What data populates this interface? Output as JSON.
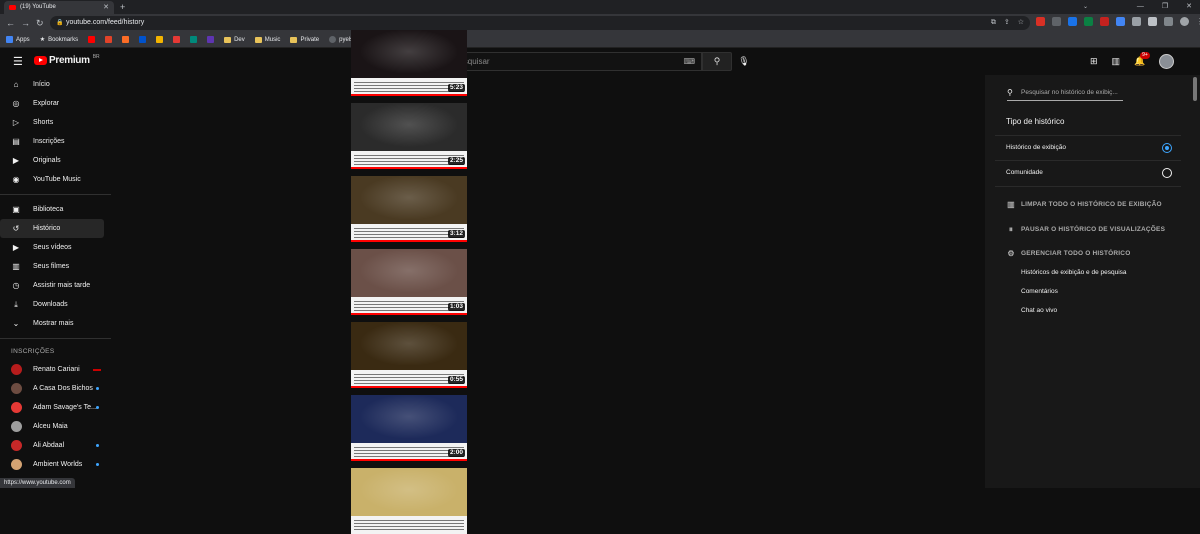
{
  "browser": {
    "tab_title": "(19) YouTube",
    "url": "youtube.com/feed/history",
    "bookmarks": [
      {
        "label": "Apps"
      },
      {
        "label": "Bookmarks"
      },
      {
        "label": "Dev"
      },
      {
        "label": "Music"
      },
      {
        "label": "Private"
      },
      {
        "label": "pyelsaaudio/record..."
      }
    ],
    "status_url": "https://www.youtube.com"
  },
  "header": {
    "logo_text": "Premium",
    "logo_country": "BR",
    "search_placeholder": "Pesquisar",
    "notification_count": "9+"
  },
  "guide": {
    "primary": [
      {
        "label": "Início",
        "icon": "home-icon",
        "glyph": "⌂"
      },
      {
        "label": "Explorar",
        "icon": "compass-icon",
        "glyph": "◎"
      },
      {
        "label": "Shorts",
        "icon": "shorts-icon",
        "glyph": "▷"
      },
      {
        "label": "Inscrições",
        "icon": "subscriptions-icon",
        "glyph": "▤"
      },
      {
        "label": "Originals",
        "icon": "originals-icon",
        "glyph": "▶"
      },
      {
        "label": "YouTube Music",
        "icon": "music-icon",
        "glyph": "◉"
      }
    ],
    "library": [
      {
        "label": "Biblioteca",
        "icon": "library-icon",
        "glyph": "▣"
      },
      {
        "label": "Histórico",
        "icon": "history-icon",
        "glyph": "↺",
        "active": true
      },
      {
        "label": "Seus vídeos",
        "icon": "your-videos-icon",
        "glyph": "▶"
      },
      {
        "label": "Seus filmes",
        "icon": "movies-icon",
        "glyph": "▥"
      },
      {
        "label": "Assistir mais tarde",
        "icon": "watch-later-icon",
        "glyph": "◷"
      },
      {
        "label": "Downloads",
        "icon": "download-icon",
        "glyph": "⤓"
      },
      {
        "label": "Mostrar mais",
        "icon": "chevron-down-icon",
        "glyph": "⌄"
      }
    ],
    "subscriptions_heading": "INSCRIÇÕES",
    "subscriptions": [
      {
        "label": "Renato Cariani",
        "avatar_color": "#b71c1c",
        "badge": "live"
      },
      {
        "label": "A Casa Dos Bichos",
        "avatar_color": "#6d4c41",
        "badge": "dot"
      },
      {
        "label": "Adam Savage's Te...",
        "avatar_color": "#e53935",
        "badge": "dot"
      },
      {
        "label": "Alceu Maia",
        "avatar_color": "#9e9e9e",
        "badge": ""
      },
      {
        "label": "Ali Abdaal",
        "avatar_color": "#c62828",
        "badge": "dot"
      },
      {
        "label": "Ambient Worlds",
        "avatar_color": "#d4a373",
        "badge": "dot"
      }
    ]
  },
  "feed": {
    "videos": [
      {
        "duration": "5:23",
        "scene_color": "#1a1416"
      },
      {
        "duration": "2:25",
        "scene_color": "#2b2b2b"
      },
      {
        "duration": "3:12",
        "scene_color": "#4a3a22"
      },
      {
        "duration": "1:03",
        "scene_color": "#6b5048"
      },
      {
        "duration": "0:55",
        "scene_color": "#3a2a12"
      },
      {
        "duration": "2:00",
        "scene_color": "#1d2a5a"
      },
      {
        "duration": "",
        "scene_color": "#c9b16a"
      }
    ]
  },
  "history_panel": {
    "search_placeholder": "Pesquisar no histórico de exibiç...",
    "type_title": "Tipo de histórico",
    "options": [
      {
        "label": "Histórico de exibição",
        "selected": true
      },
      {
        "label": "Comunidade",
        "selected": false
      }
    ],
    "actions": [
      {
        "label": "LIMPAR TODO O HISTÓRICO DE EXIBIÇÃO",
        "icon": "trash-icon",
        "glyph": "🗑"
      },
      {
        "label": "PAUSAR O HISTÓRICO DE VISUALIZAÇÕES",
        "icon": "pause-icon",
        "glyph": "⏸"
      },
      {
        "label": "GERENCIAR TODO O HISTÓRICO",
        "icon": "gear-icon",
        "glyph": "⚙"
      }
    ],
    "links": [
      {
        "label": "Históricos de exibição e de pesquisa"
      },
      {
        "label": "Comentários"
      },
      {
        "label": "Chat ao vivo"
      }
    ]
  }
}
